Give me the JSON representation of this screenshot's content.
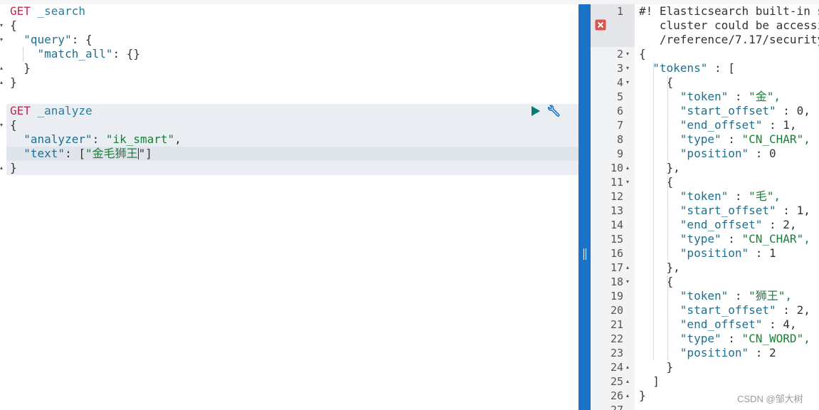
{
  "left_editor": {
    "lines": [
      {
        "method": "GET",
        "url": " _search"
      },
      {
        "text": "{"
      },
      {
        "key": "\"query\"",
        "rest": ": {"
      },
      {
        "key": "\"match_all\"",
        "rest": ": {}"
      },
      {
        "text": "}"
      },
      {
        "text": "}"
      },
      {
        "text": ""
      },
      {
        "method": "GET",
        "url": " _analyze"
      },
      {
        "text": "{"
      },
      {
        "key": "\"analyzer\"",
        "rest_p": ": ",
        "val": "\"ik_smart\"",
        "tail": ","
      },
      {
        "key": "\"text\"",
        "rest_p": ": [",
        "val": "\"金毛狮王",
        "tail2": "\"]"
      },
      {
        "text": "}"
      }
    ],
    "run_icon": "play-icon",
    "settings_icon": "wrench-icon"
  },
  "right_output": {
    "line_numbers": [
      "1",
      "",
      "",
      "2",
      "3",
      "4",
      "5",
      "6",
      "7",
      "8",
      "9",
      "10",
      "11",
      "12",
      "13",
      "14",
      "15",
      "16",
      "17",
      "18",
      "19",
      "20",
      "21",
      "22",
      "23",
      "24",
      "25",
      "26",
      "27"
    ],
    "warning_lines": [
      "#! Elasticsearch built-in s",
      "   cluster could be accessib",
      "   /reference/7.17/security"
    ],
    "lines": [
      "{",
      "  \"tokens\" : [",
      "    {",
      "      \"token\" : \"金\",",
      "      \"start_offset\" : 0,",
      "      \"end_offset\" : 1,",
      "      \"type\" : \"CN_CHAR\",",
      "      \"position\" : 0",
      "    },",
      "    {",
      "      \"token\" : \"毛\",",
      "      \"start_offset\" : 1,",
      "      \"end_offset\" : 2,",
      "      \"type\" : \"CN_CHAR\",",
      "      \"position\" : 1",
      "    },",
      "    {",
      "      \"token\" : \"狮王\",",
      "      \"start_offset\" : 2,",
      "      \"end_offset\" : 4,",
      "      \"type\" : \"CN_WORD\",",
      "      \"position\" : 2",
      "    }",
      "  ]",
      "}"
    ],
    "error_icon": "error-icon"
  },
  "watermark": "CSDN @邹大树",
  "colors": {
    "divider": "#1a73c7",
    "method": "#c7254e",
    "string": "#1a7f37",
    "key": "#1f6f8f"
  }
}
